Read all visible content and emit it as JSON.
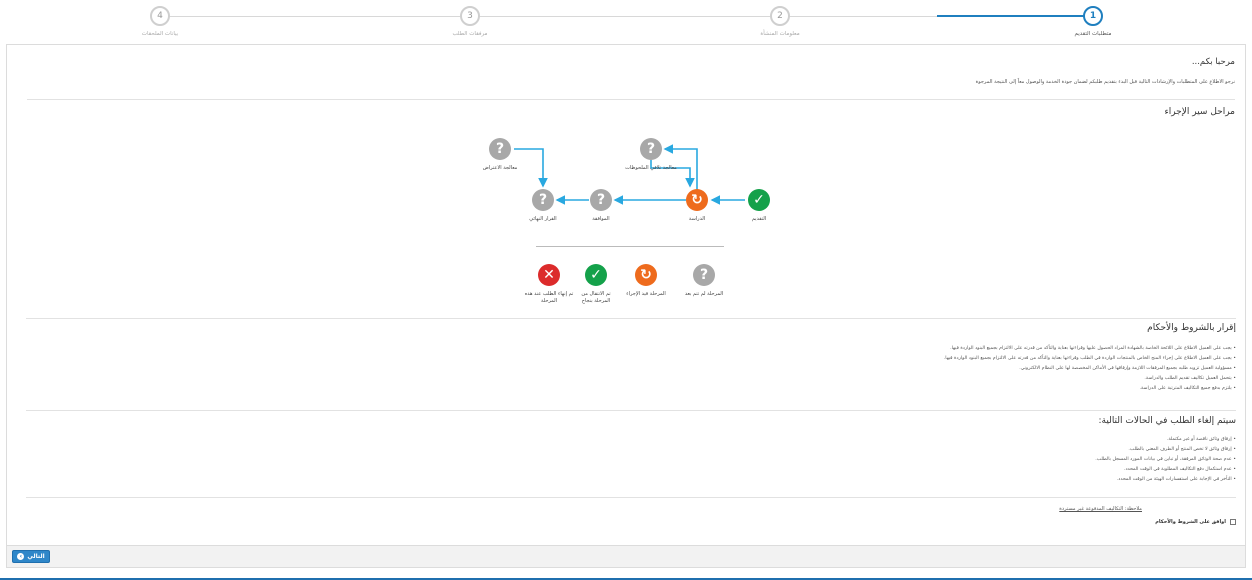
{
  "stepper": {
    "steps": [
      {
        "num": "1",
        "label": "متطلبات التقديم",
        "active": true
      },
      {
        "num": "2",
        "label": "معلومات المنشأة",
        "active": false
      },
      {
        "num": "3",
        "label": "مرفقات الطلب",
        "active": false
      },
      {
        "num": "4",
        "label": "بيانات الملحقات",
        "active": false
      }
    ]
  },
  "welcome": {
    "title": "مرحبا بكم...",
    "text": "نرجو الاطلاع على المتطلبات والإرشادات التالية قبل البدء بتقديم طلبكم لضمان جودة الخدمة والوصول معاً إلى النتيجة المرجوة"
  },
  "workflow": {
    "title": "مراحل سير الإجراء",
    "nodes": [
      {
        "id": "submit",
        "label": "التقديم",
        "status": "green"
      },
      {
        "id": "study",
        "label": "الدراسة",
        "status": "orange"
      },
      {
        "id": "approval",
        "label": "الموافقة",
        "status": "gray"
      },
      {
        "id": "final",
        "label": "القرار النهائي",
        "status": "gray"
      },
      {
        "id": "remarks",
        "label": "معالجة تلافي الملحوظات",
        "status": "gray"
      },
      {
        "id": "objection",
        "label": "معالجة الاعتراض",
        "status": "gray"
      }
    ],
    "legend": [
      {
        "status": "gray",
        "label": "المرحلة لم تتم بعد"
      },
      {
        "status": "orange",
        "label": "المرحلة قيد الإجراء"
      },
      {
        "status": "green",
        "label": "تم الانتقال من المرحلة بنجاح"
      },
      {
        "status": "red",
        "label": "تم إنهاء الطلب عند هذه المرحلة"
      }
    ]
  },
  "terms": {
    "title": "إقرار بالشروط والأحكام",
    "items": [
      "يجب على العميل الاطلاع على اللائحة الخاصة بالشهادة المراد الحصول عليها وقراءتها بعناية والتأكد من قدرته على الالتزام بجميع البنود الواردة فيها.",
      "يجب على العميل الاطلاع على إجراء المنح الخاص بالمنتجات الواردة في الطلب وقراءتها بعناية والتأكد من قدرته على الالتزام بجميع البنود الواردة فيها.",
      "مسؤولية العميل تزويد طلبه بجميع المرفقات اللازمة وإرفاقها في الأماكن المخصصة لها على النظام الالكتروني.",
      "يتحمل العميل تكاليف تقديم الطلب والدراسة.",
      "يلتزم بدفع جميع التكاليف المترتبة على الدراسة."
    ]
  },
  "cancel": {
    "title": "سيتم إلغاء الطلب في الحالات التالية:",
    "items": [
      "إرفاق وثائق ناقصة أو غير مكتملة.",
      "إرفاق وثائق لا تخص المنتج أو الطرف المعني بالطلب.",
      "عدم صحة الوثائق المرفقة، أو تباين في بيانات المورد المسجل بالطلب.",
      "عدم استكمال دفع التكاليف المطلوبة في الوقت المحدد.",
      "التأخر في الإجابة على استفسارات الهيئة من الوقت المحدد."
    ]
  },
  "note": "ملاحظة: التكاليف المدفوعة غير مستردة",
  "agree_label": "اوافق على الشروط والأحكام",
  "footer": {
    "next_label": "التالي"
  },
  "colors": {
    "primary": "#1f7fbf",
    "green": "#14a14a",
    "orange": "#ee6b1d",
    "red": "#dc2b2b",
    "gray": "#a8a8a8"
  }
}
